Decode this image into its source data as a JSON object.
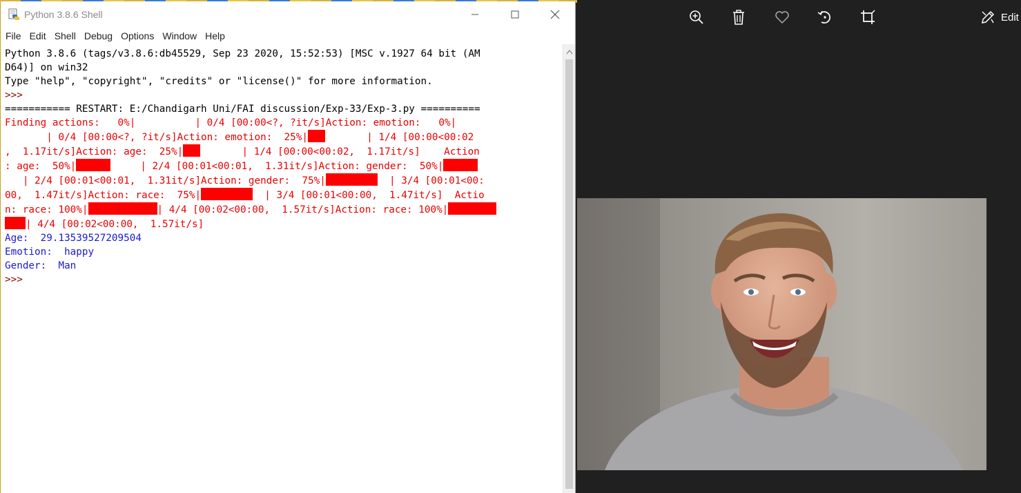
{
  "window": {
    "title": "Python 3.8.6 Shell",
    "menu": [
      "File",
      "Edit",
      "Shell",
      "Debug",
      "Options",
      "Window",
      "Help"
    ]
  },
  "shell": {
    "banner_1": "Python 3.8.6 (tags/v3.8.6:db45529, Sep 23 2020, 15:52:53) [MSC v.1927 64 bit (AM",
    "banner_2": "D64)] on win32",
    "banner_3": "Type \"help\", \"copyright\", \"credits\" or \"license()\" for more information.",
    "prompt": ">>>",
    "restart": "=========== RESTART: E:/Chandigarh Uni/FAI discussion/Exp-33/Exp-3.py ==========",
    "progress": {
      "l1": "Finding actions:   0%|          | 0/4 [00:00<?, ?it/s]Action: emotion:   0%|",
      "l2_a": "       | 0/4 [00:00<?, ?it/s]Action: emotion:  25%|",
      "l2_b": "       | 1/4 [00:00<00:02",
      "l3_a": ",  1.17it/s]Action: age:  25%|",
      "l3_b": "       | 1/4 [00:00<00:02,  1.17it/s]    Action",
      "l4_a": ": age:  50%|",
      "l4_b": "     | 2/4 [00:01<00:01,  1.31it/s]Action: gender:  50%|",
      "l5_a": "   | 2/4 [00:01<00:01,  1.31it/s]Action: gender:  75%|",
      "l5_b": "  | 3/4 [00:01<00:",
      "l6_a": "00,  1.47it/s]Action: race:  75%|",
      "l6_b": "  | 3/4 [00:01<00:00,  1.47it/s]  Actio",
      "l7_a": "n: race: 100%|",
      "l7_b": "| 4/4 [00:02<00:00,  1.57it/s]Action: race: 100%|",
      "l8_b": "| 4/4 [00:02<00:00,  1.57it/s]"
    },
    "result_age": "Age:  29.13539527209504",
    "result_emotion": "Emotion:  happy",
    "result_gender": "Gender:  Man",
    "final_prompt": ">>>"
  },
  "photos": {
    "edit_label": "Edit",
    "toolbar_icons": [
      "zoom-in-icon",
      "delete-icon",
      "favorite-icon",
      "rotate-icon",
      "crop-icon",
      "edit-icon"
    ]
  },
  "colors": {
    "stderr": "#e80000",
    "stdout": "#1a1acc",
    "prompt": "#8b0000",
    "progress_bar": "#ff0000",
    "viewer_bg": "#202020"
  }
}
